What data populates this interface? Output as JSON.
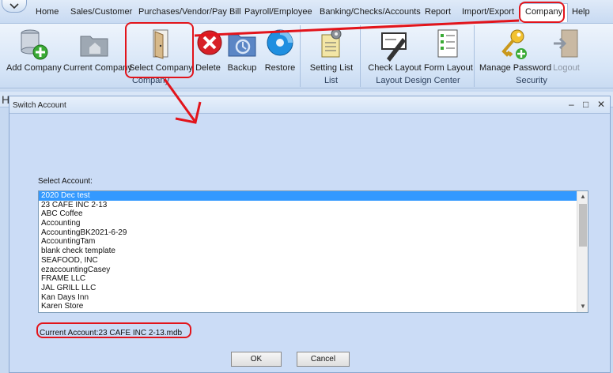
{
  "menu": {
    "items": [
      "Home",
      "Sales/Customer",
      "Purchases/Vendor/Pay Bill",
      "Payroll/Employee",
      "Banking/Checks/Accounts",
      "Report",
      "Import/Export",
      "Company",
      "Help"
    ]
  },
  "ribbon": {
    "company_group": {
      "label": "Company",
      "buttons": [
        "Add Company",
        "Current Company",
        "Select Company",
        "Delete",
        "Backup",
        "Restore"
      ]
    },
    "list_group": {
      "label": "List",
      "buttons": [
        "Setting List"
      ]
    },
    "layout_group": {
      "label": "Layout Design Center",
      "buttons": [
        "Check  Layout",
        "Form Layout"
      ]
    },
    "security_group": {
      "label": "Security",
      "buttons": [
        "Manage Password",
        "Logout"
      ]
    }
  },
  "workspace": {
    "back_header": "H"
  },
  "dialog": {
    "title": "Switch Account",
    "controls": {
      "minimize": "–",
      "maximize": "□",
      "close": "✕"
    },
    "select_label": "Select Account:",
    "accounts": [
      "2020 Dec test",
      "23 CAFE INC 2-13",
      "ABC Coffee",
      "Accounting",
      "AccountingBK2021-6-29",
      "AccountingTam",
      "blank check template",
      "SEAFOOD, INC",
      "ezaccountingCasey",
      "FRAME LLC",
      "JAL GRILL LLC",
      "Kan Days Inn",
      "Karen Store"
    ],
    "selected_index": 0,
    "current_account": "Current Account:23 CAFE INC 2-13.mdb",
    "ok_label": "OK",
    "cancel_label": "Cancel"
  },
  "colors": {
    "annotation": "#e2141b",
    "selection": "#3399ff"
  }
}
